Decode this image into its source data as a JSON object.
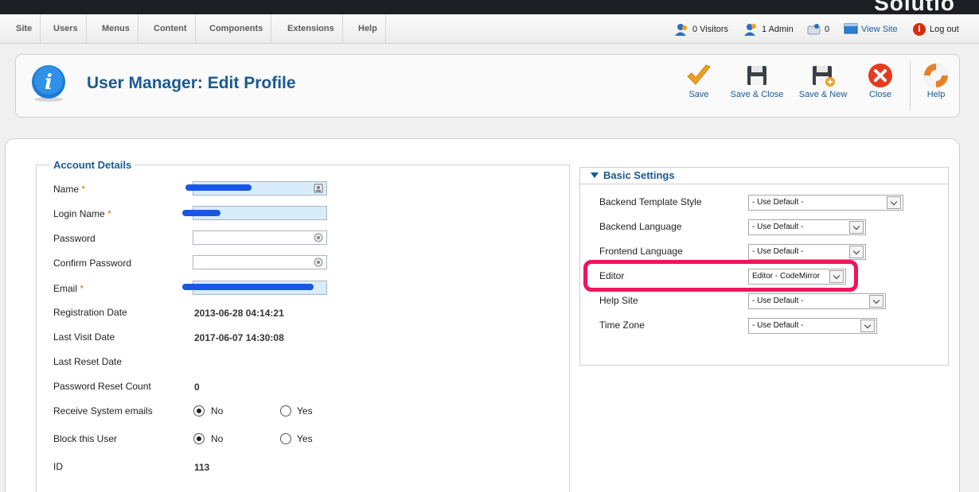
{
  "brand": "Solutio",
  "menu": [
    "Site",
    "Users",
    "Menus",
    "Content",
    "Components",
    "Extensions",
    "Help"
  ],
  "status": {
    "visitors": "0 Visitors",
    "admins": "1 Admin",
    "messages": "0",
    "view_site": "View Site",
    "logout": "Log out"
  },
  "toolbar": {
    "title": "User Manager: Edit Profile",
    "buttons": {
      "save": "Save",
      "save_close": "Save & Close",
      "save_new": "Save & New",
      "close": "Close",
      "help": "Help"
    }
  },
  "account": {
    "legend": "Account Details",
    "required_mark": "*",
    "labels": {
      "name": "Name",
      "login": "Login Name",
      "password": "Password",
      "confirm": "Confirm Password",
      "email": "Email",
      "reg_date": "Registration Date",
      "last_visit": "Last Visit Date",
      "last_reset": "Last Reset Date",
      "reset_count": "Password Reset Count",
      "receive_emails": "Receive System emails",
      "block": "Block this User",
      "id": "ID"
    },
    "values": {
      "reg_date": "2013-06-28 04:14:21",
      "last_visit": "2017-06-07 14:30:08",
      "reset_count": "0",
      "id": "113"
    },
    "radio": {
      "no": "No",
      "yes": "Yes"
    }
  },
  "settings": {
    "heading": "Basic Settings",
    "rows": [
      {
        "label": "Backend Template Style",
        "value": "- Use Default -"
      },
      {
        "label": "Backend Language",
        "value": "- Use Default -"
      },
      {
        "label": "Frontend Language",
        "value": "- Use Default -"
      },
      {
        "label": "Editor",
        "value": "Editor - CodeMirror"
      },
      {
        "label": "Help Site",
        "value": "- Use Default -"
      },
      {
        "label": "Time Zone",
        "value": "- Use Default -"
      }
    ]
  },
  "colors": {
    "accent": "#1a5a92",
    "highlight_ring": "#f0145c",
    "redaction": "#1a56e6"
  }
}
